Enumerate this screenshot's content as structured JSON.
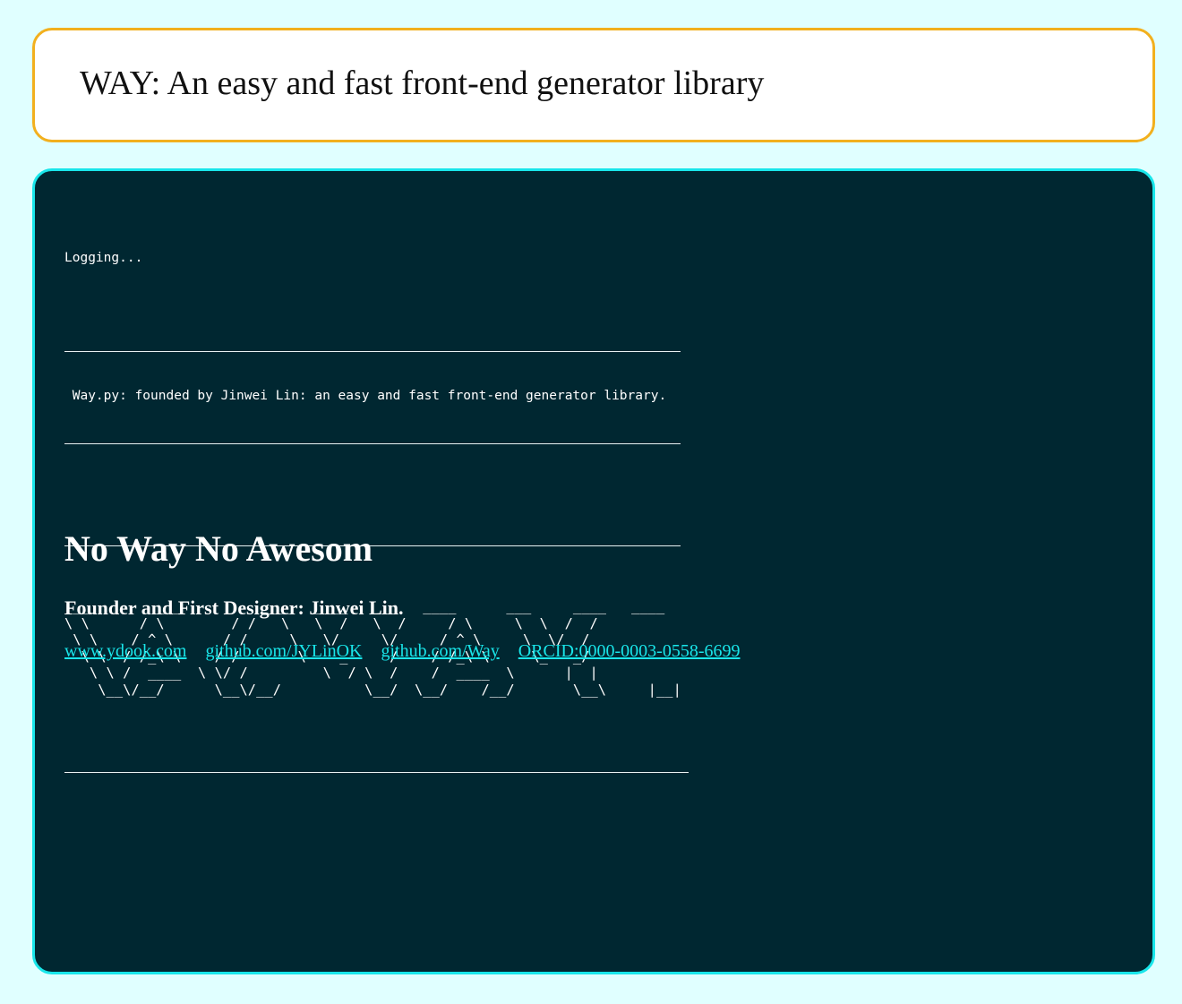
{
  "header": {
    "title": "WAY: An easy and fast front-end generator library"
  },
  "console": {
    "logging": "Logging...",
    "banner": " Way.py: founded by Jinwei Lin: an easy and fast front-end generator library.",
    "ascii_art": "___        ___          ___   ____   ___   ____      ___     ____   ____\n\\ \\      / \\        / /   \\   \\  /   \\  /     / \\     \\  \\  /  /\n \\ \\    / ^ \\      / /     \\   \\/     \\/     / ^ \\     \\  \\/  /\n  \\ \\  / /_\\ \\    / /       \\    _     /    / /_\\ \\     \\_   _/\n   \\ \\ /  ____  \\ \\/ /         \\  / \\  /    /  ____  \\      |  |\n    \\__\\/__/      \\__\\/__/          \\__/  \\__/    /__/       \\__\\     |__|"
  },
  "slogan": "No Way No Awesom",
  "founder": "Founder and First Designer: Jinwei Lin.",
  "links": [
    {
      "label": "www.ydook.com"
    },
    {
      "label": "github.com/JYLinOK"
    },
    {
      "label": "github.com/Way"
    },
    {
      "label": "ORCID:0000-0003-0558-6699"
    }
  ],
  "colors": {
    "page_background": "#e0ffff",
    "header_border": "#f2b01e",
    "panel_background": "#002731",
    "panel_border": "#19e6ea",
    "link": "#19e6ea"
  }
}
